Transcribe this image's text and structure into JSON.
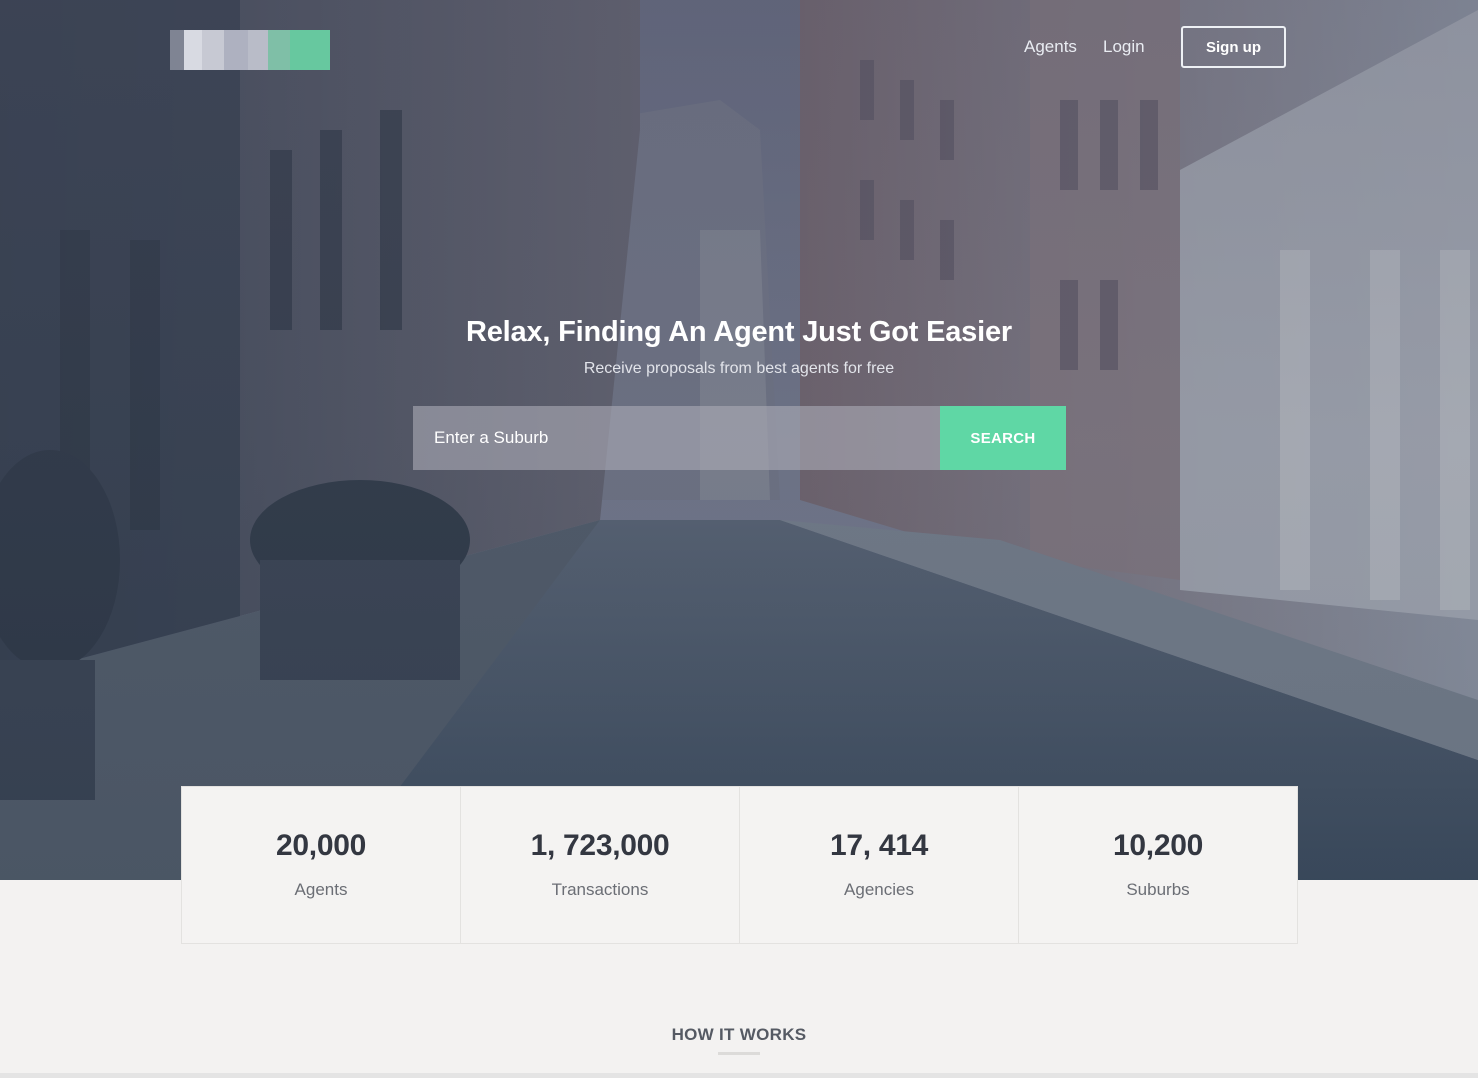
{
  "nav": {
    "agents_label": "Agents",
    "login_label": "Login",
    "signup_label": "Sign up"
  },
  "hero": {
    "headline": "Relax, Finding An Agent Just Got Easier",
    "subheadline": "Receive proposals from best agents for free",
    "search": {
      "placeholder": "Enter a Suburb",
      "button_label": "SEARCH"
    }
  },
  "stats": [
    {
      "value": "20,000",
      "label": "Agents"
    },
    {
      "value": "1, 723,000",
      "label": "Transactions"
    },
    {
      "value": "17, 414",
      "label": "Agencies"
    },
    {
      "value": "10,200",
      "label": "Suburbs"
    }
  ],
  "how_it_works": {
    "title": "HOW IT WORKS"
  },
  "colors": {
    "accent": "#5fd7a5",
    "text_dark": "#333741",
    "page_background": "#f3f2f1"
  },
  "icons": {
    "logo": "blurred-logo"
  }
}
